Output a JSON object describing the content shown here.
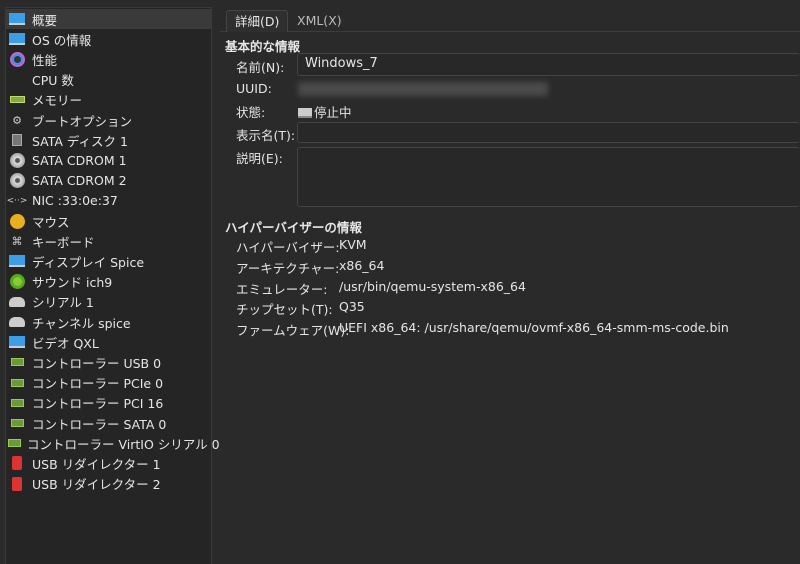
{
  "sidebar": {
    "items": [
      {
        "label": "概要",
        "icon": "monitor-icon",
        "selected": true
      },
      {
        "label": "OS の情報",
        "icon": "monitor-icon"
      },
      {
        "label": "性能",
        "icon": "performance-gauge-icon"
      },
      {
        "label": "CPU 数",
        "icon": "none"
      },
      {
        "label": "メモリー",
        "icon": "memory-icon"
      },
      {
        "label": "ブートオプション",
        "icon": "gears-icon"
      },
      {
        "label": "SATA ディスク 1",
        "icon": "hard-disk-icon"
      },
      {
        "label": "SATA CDROM 1",
        "icon": "cdrom-icon"
      },
      {
        "label": "SATA CDROM 2",
        "icon": "cdrom-icon"
      },
      {
        "label": "NIC :33:0e:37",
        "icon": "network-icon"
      },
      {
        "label": "マウス",
        "icon": "mouse-icon"
      },
      {
        "label": "キーボード",
        "icon": "keyboard-icon"
      },
      {
        "label": "ディスプレイ Spice",
        "icon": "monitor-icon"
      },
      {
        "label": "サウンド ich9",
        "icon": "sound-icon"
      },
      {
        "label": "シリアル 1",
        "icon": "serial-icon"
      },
      {
        "label": "チャンネル spice",
        "icon": "serial-icon"
      },
      {
        "label": "ビデオ QXL",
        "icon": "monitor-icon"
      },
      {
        "label": "コントローラー USB 0",
        "icon": "controller-icon"
      },
      {
        "label": "コントローラー PCIe 0",
        "icon": "controller-icon"
      },
      {
        "label": "コントローラー PCI 16",
        "icon": "controller-icon"
      },
      {
        "label": "コントローラー SATA 0",
        "icon": "controller-icon"
      },
      {
        "label": "コントローラー VirtIO シリアル 0",
        "icon": "controller-icon"
      },
      {
        "label": "USB リダイレクター 1",
        "icon": "usb-redirector-icon"
      },
      {
        "label": "USB リダイレクター 2",
        "icon": "usb-redirector-icon"
      }
    ]
  },
  "tabs": [
    {
      "label": "詳細(D)",
      "active": true
    },
    {
      "label": "XML(X)"
    }
  ],
  "basic": {
    "heading": "基本的な情報",
    "name_label": "名前(N):",
    "name_value": "Windows_7",
    "uuid_label": "UUID:",
    "state_label": "状態:",
    "state_value": "停止中",
    "title_label": "表示名(T):",
    "title_value": "",
    "desc_label": "説明(E):",
    "desc_value": ""
  },
  "hypervisor": {
    "heading": "ハイパーバイザーの情報",
    "rows": [
      {
        "label": "ハイパーバイザー:",
        "value": "KVM"
      },
      {
        "label": "アーキテクチャー:",
        "value": "x86_64"
      },
      {
        "label": "エミュレーター:",
        "value": "/usr/bin/qemu-system-x86_64"
      },
      {
        "label": "チップセット(T):",
        "value": "Q35"
      },
      {
        "label": "ファームウェア(W):",
        "value": "UEFI x86_64: /usr/share/qemu/ovmf-x86_64-smm-ms-code.bin"
      }
    ]
  }
}
